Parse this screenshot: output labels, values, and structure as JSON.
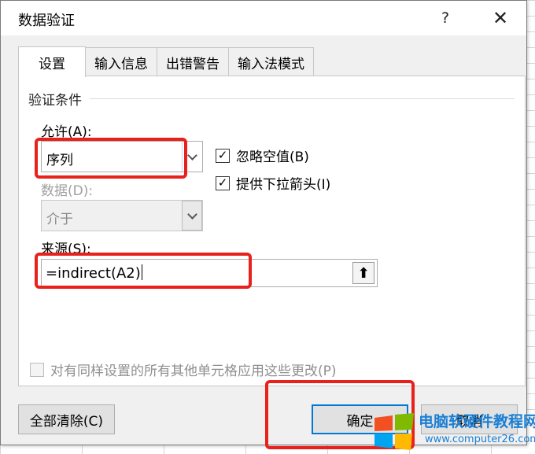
{
  "dialog": {
    "title": "数据验证",
    "help": "?",
    "close": "✕"
  },
  "tabs": [
    "设置",
    "输入信息",
    "出错警告",
    "输入法模式"
  ],
  "settings": {
    "group_title": "验证条件",
    "allow_label": "允许(A):",
    "allow_value": "序列",
    "data_label": "数据(D):",
    "data_value": "介于",
    "ignore_blank": {
      "label": "忽略空值(B)",
      "checked": true
    },
    "dropdown": {
      "label": "提供下拉箭头(I)",
      "checked": true
    },
    "source_label": "来源(S):",
    "source_value": "=indirect(A2)",
    "apply_all": {
      "label": "对有同样设置的所有其他单元格应用这些更改(P)",
      "checked": false
    }
  },
  "buttons": {
    "clear_all": "全部清除(C)",
    "ok": "确定",
    "cancel": "取消"
  },
  "watermark": {
    "title": "电脑软硬件教程网",
    "url": "www.computer26.com"
  },
  "colors": {
    "highlight": "#e8211c",
    "accent": "#0078d7"
  }
}
